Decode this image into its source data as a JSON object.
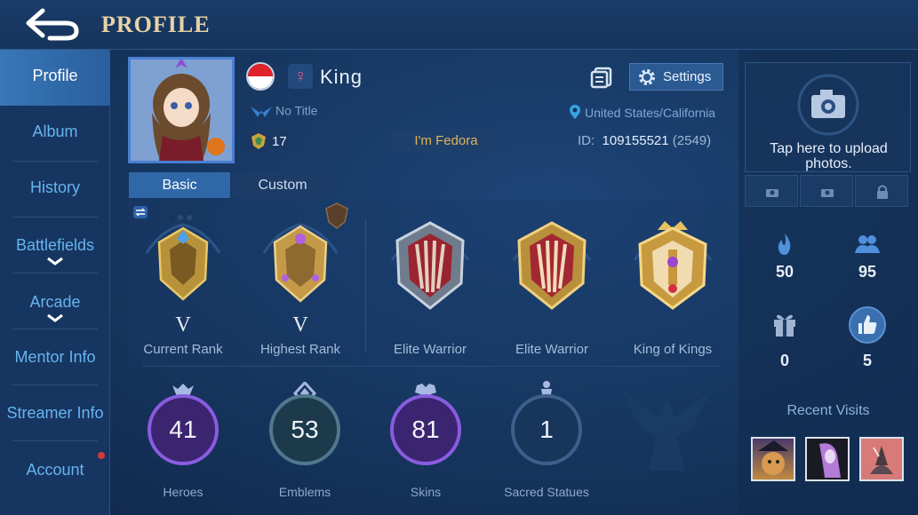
{
  "header": {
    "title": "PROFILE",
    "back_icon": "back-arrow-icon"
  },
  "sidebar": {
    "items": [
      {
        "label": "Profile",
        "active": true
      },
      {
        "label": "Album"
      },
      {
        "label": "History"
      },
      {
        "label": "Battlefields",
        "expandable": true
      },
      {
        "label": "Arcade",
        "expandable": true
      },
      {
        "label": "Mentor Info"
      },
      {
        "label": "Streamer Info"
      },
      {
        "label": "Account",
        "badge": "red-dot"
      }
    ]
  },
  "profile": {
    "name": "King",
    "gender_symbol": "♀",
    "title": "No Title",
    "level": "17",
    "motto": "I'm Fedora",
    "location": "United States/California",
    "id_label": "ID:",
    "id_value": "109155521",
    "server": "(2549)",
    "settings_label": "Settings"
  },
  "tabs": [
    {
      "label": "Basic",
      "active": true
    },
    {
      "label": "Custom"
    }
  ],
  "ranks": [
    {
      "label": "Current Rank",
      "tier": "V"
    },
    {
      "label": "Highest Rank",
      "tier": "V"
    },
    {
      "label": "Elite Warrior"
    },
    {
      "label": "Elite Warrior"
    },
    {
      "label": "King of Kings"
    }
  ],
  "stats": [
    {
      "label": "Heroes",
      "value": "41"
    },
    {
      "label": "Emblems",
      "value": "53"
    },
    {
      "label": "Skins",
      "value": "81"
    },
    {
      "label": "Sacred Statues",
      "value": "1"
    }
  ],
  "right_panel": {
    "upload_text": "Tap here to upload photos.",
    "popularity": "50",
    "followers": "95",
    "gifts": "0",
    "likes": "5",
    "recent_visits_label": "Recent Visits"
  },
  "colors": {
    "accent": "#2f67a8",
    "sidebar_text": "#66b4f0",
    "title_gold": "#e8d2a6",
    "motto_gold": "#e2b457"
  }
}
